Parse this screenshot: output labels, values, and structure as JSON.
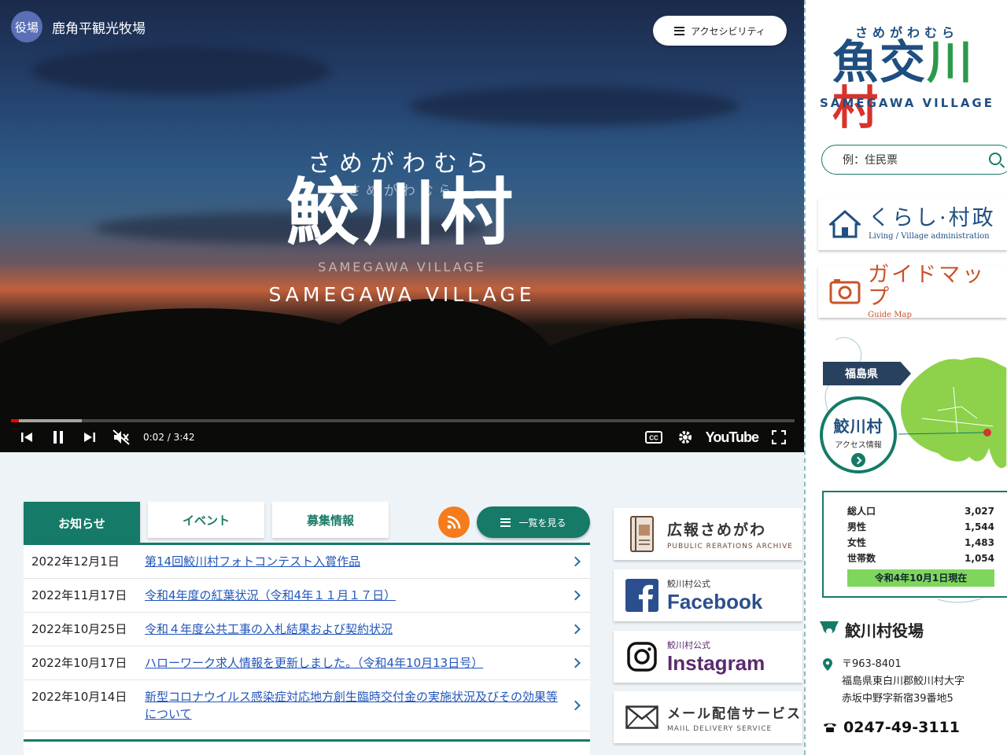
{
  "video": {
    "channel_avatar": "役場",
    "title": "鹿角平観光牧場",
    "accessibility_label": "アクセシビリティ",
    "logo_kana": "さめがわむら",
    "logo_kanji": "鮫川村",
    "logo_roman": "SAMEGAWA VILLAGE",
    "ghost_kana": "さめがわむら",
    "ghost_roman": "SAMEGAWA VILLAGE",
    "time": "0:02 / 3:42",
    "progress": 0.01,
    "youtube_label": "YouTube"
  },
  "news": {
    "tabs": [
      {
        "label": "お知らせ",
        "active": true
      },
      {
        "label": "イベント",
        "active": false
      },
      {
        "label": "募集情報",
        "active": false
      }
    ],
    "view_all_label": "一覧を見る",
    "items": [
      {
        "date": "2022年12月1日",
        "title": "第14回鮫川村フォトコンテスト入賞作品"
      },
      {
        "date": "2022年11月17日",
        "title": "令和4年度の紅葉状況（令和4年１１月１７日）"
      },
      {
        "date": "2022年10月25日",
        "title": "令和４年度公共工事の入札結果および契約状況"
      },
      {
        "date": "2022年10月17日",
        "title": "ハローワーク求人情報を更新しました。（令和4年10月13日号）"
      },
      {
        "date": "2022年10月14日",
        "title": "新型コロナウイルス感染症対応地方創生臨時交付金の実施状況及びその効果等について"
      }
    ]
  },
  "banners": {
    "koho_title": "広報さめがわ",
    "koho_sub": "PUBULIC RERATIONS ARCHIVE",
    "fb_small": "鮫川村公式",
    "fb_title": "Facebook",
    "ig_small": "鮫川村公式",
    "ig_title": "Instagram",
    "mail_title": "メール配信サービス",
    "mail_sub": "MAIIL DELIVERY SERVICE"
  },
  "sidebar": {
    "logo_kana": "さめがわむら",
    "logo_kanji": [
      "魚",
      "交",
      "川",
      "村"
    ],
    "logo_roman": "SAMEGAWA VILLAGE",
    "search_placeholder": "例：住民票",
    "kurashi_title": "くらし·村政",
    "kurashi_sub": "Living / Village administration",
    "guide_title": "ガイドマップ",
    "guide_sub": "Guide Map",
    "pref_label": "福島県",
    "access_title": "鮫川村",
    "access_sub": "アクセス情報",
    "population": [
      {
        "label": "総人口",
        "value": "3,027"
      },
      {
        "label": "男性",
        "value": "1,544"
      },
      {
        "label": "女性",
        "value": "1,483"
      },
      {
        "label": "世帯数",
        "value": "1,054"
      }
    ],
    "population_date": "令和4年10月1日現在",
    "office_name": "鮫川村役場",
    "postal": "〒963-8401",
    "address1": "福島県東白川郡鮫川村大字",
    "address2": "赤坂中野字新宿39番地5",
    "tel": "0247-49-3111"
  },
  "colors": {
    "accent": "#157a68",
    "navy": "#1f4f80",
    "kurashi": "#1f4f80",
    "guide": "#c8532a",
    "rss": "#f47c1c"
  }
}
